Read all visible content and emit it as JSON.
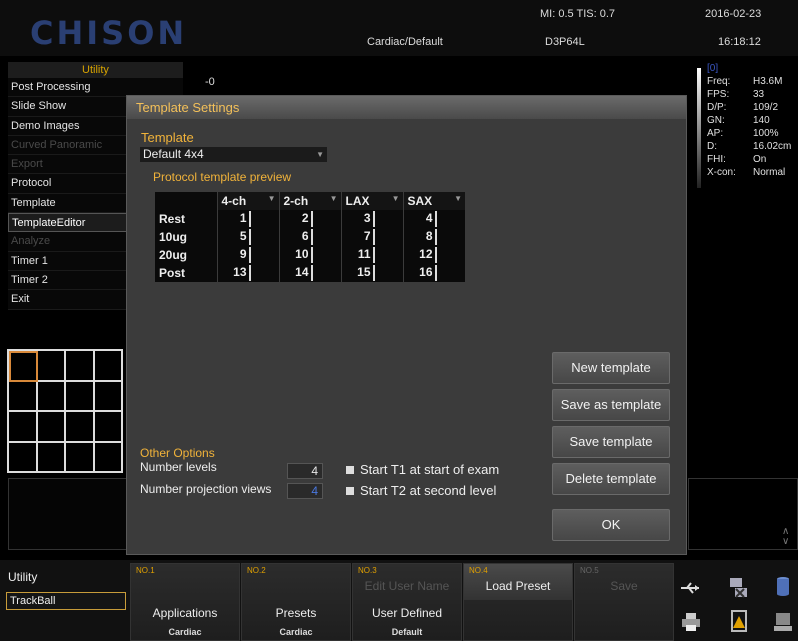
{
  "header": {
    "logo": "CHISON",
    "mi_tis": "MI: 0.5  TIS: 0.7",
    "date": "2016-02-23",
    "preset": "Cardiac/Default",
    "probe": "D3P64L",
    "time": "16:18:12"
  },
  "utility_menu": {
    "title": "Utility",
    "items": [
      {
        "label": "Post Processing",
        "enabled": true
      },
      {
        "label": "Slide Show",
        "enabled": true
      },
      {
        "label": "Demo Images",
        "enabled": true
      },
      {
        "label": "Curved Panoramic",
        "enabled": false
      },
      {
        "label": "Export",
        "enabled": false
      },
      {
        "label": "Protocol",
        "enabled": true
      },
      {
        "label": "Template",
        "enabled": true
      },
      {
        "label": "TemplateEditor",
        "enabled": true,
        "active": true
      },
      {
        "label": "Analyze",
        "enabled": false
      },
      {
        "label": "Timer 1",
        "enabled": true
      },
      {
        "label": "Timer 2",
        "enabled": true
      },
      {
        "label": "Exit",
        "enabled": true
      }
    ]
  },
  "scale_label": "-0",
  "right_info": {
    "frame_tag": "[0]",
    "rows": [
      {
        "k": "Freq:",
        "v": "H3.6M"
      },
      {
        "k": "FPS:",
        "v": "33"
      },
      {
        "k": "D/P:",
        "v": "109/2"
      },
      {
        "k": "GN:",
        "v": "140"
      },
      {
        "k": "AP:",
        "v": "100%"
      },
      {
        "k": "D:",
        "v": "16.02cm"
      },
      {
        "k": "FHI:",
        "v": "On"
      },
      {
        "k": "X-con:",
        "v": "Normal"
      }
    ]
  },
  "dialog": {
    "title": "Template Settings",
    "template_label": "Template",
    "template_value": "Default 4x4",
    "preview_label": "Protocol template preview",
    "columns": [
      "4-ch",
      "2-ch",
      "LAX",
      "SAX"
    ],
    "rows": [
      {
        "label": "Rest",
        "cells": [
          "1",
          "2",
          "3",
          "4"
        ]
      },
      {
        "label": "10ug",
        "cells": [
          "5",
          "6",
          "7",
          "8"
        ]
      },
      {
        "label": "20ug",
        "cells": [
          "9",
          "10",
          "11",
          "12"
        ]
      },
      {
        "label": "Post",
        "cells": [
          "13",
          "14",
          "15",
          "16"
        ]
      }
    ],
    "other_options_label": "Other Options",
    "number_levels_label": "Number levels",
    "number_levels_value": "4",
    "number_views_label": "Number projection views",
    "number_views_value": "4",
    "start_t1_label": "Start T1 at start of exam",
    "start_t2_label": "Start T2 at second level",
    "buttons": {
      "new": "New template",
      "save_as": "Save as template",
      "save": "Save template",
      "delete": "Delete template",
      "ok": "OK"
    }
  },
  "bottom": {
    "title": "Utility",
    "trackball": "TrackBall",
    "tiles": [
      {
        "no": "NO.1",
        "top": "",
        "mid": "Applications",
        "sub": "Cardiac"
      },
      {
        "no": "NO.2",
        "top": "",
        "mid": "Presets",
        "sub": "Cardiac"
      },
      {
        "no": "NO.3",
        "top": "Edit User Name",
        "mid": "User Defined",
        "sub": "Default"
      },
      {
        "no": "NO.4",
        "top": "Load Preset",
        "mid": "",
        "sub": ""
      },
      {
        "no": "NO.5",
        "top": "Save",
        "mid": "",
        "sub": ""
      }
    ]
  }
}
